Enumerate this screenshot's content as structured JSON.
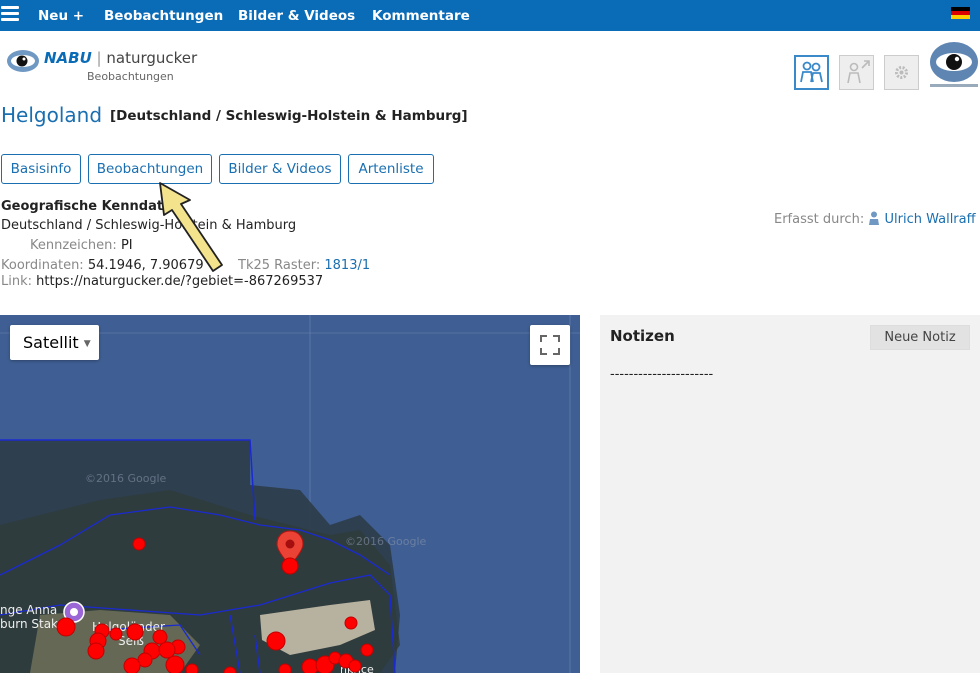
{
  "nav": {
    "items": [
      "Neu +",
      "Beobachtungen",
      "Bilder & Videos",
      "Kommentare"
    ]
  },
  "logo": {
    "brand": "NABU",
    "name": "naturgucker",
    "sub": "Beobachtungen"
  },
  "page": {
    "title": "Helgoland",
    "region": "[Deutschland / Schleswig-Holstein & Hamburg]"
  },
  "tabs": [
    "Basisinfo",
    "Beobachtungen",
    "Bilder & Videos",
    "Artenliste"
  ],
  "geo": {
    "heading": "Geografische Kenndaten",
    "region_line": "Deutschland / Schleswig-Holstein & Hamburg",
    "kennzeichen_label": "Kennzeichen:",
    "kennzeichen_value": "PI",
    "koord_label": "Koordinaten:",
    "koord_value": "54.1946, 7.90679",
    "tk25_label": "Tk25 Raster:",
    "tk25_value": "1813/1",
    "link_label": "Link:",
    "link_value": "https://naturgucker.de/?gebiet=-867269537"
  },
  "captured": {
    "label": "Erfasst durch:",
    "user": "Ulrich Wallraff"
  },
  "map": {
    "type_label": "Satellit",
    "map_labels": [
      "nge Anna",
      "burn Stak",
      "Helgoländer",
      "Seiß",
      "©2016 Google",
      "©2016 Google",
      "nkrice"
    ]
  },
  "notes": {
    "title": "Notizen",
    "button": "Neue Notiz",
    "placeholder": "----------------------"
  },
  "colors": {
    "nav_bg": "#0a6bb7",
    "link": "#1a6fb0",
    "marker": "#e60000",
    "arrow": "#f3e38c"
  }
}
